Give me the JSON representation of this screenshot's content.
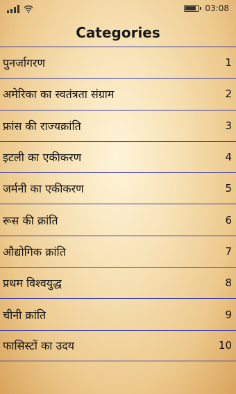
{
  "status": {
    "time": "03:08",
    "battery_level": 0.85,
    "signal_bars": 4
  },
  "header": {
    "title": "Categories"
  },
  "categories": [
    {
      "label": "पुनर्जागरण",
      "number": "1"
    },
    {
      "label": "अमेरिका का स्वतंत्रता संग्राम",
      "number": "2"
    },
    {
      "label": "फ्रांस की राज्यक्रांति",
      "number": "3"
    },
    {
      "label": "इटली का एकीकरण",
      "number": "4"
    },
    {
      "label": "जर्मनी का एकीकरण",
      "number": "5"
    },
    {
      "label": "रूस की क्रांति",
      "number": "6"
    },
    {
      "label": "औद्योगिक क्रांति",
      "number": "7"
    },
    {
      "label": "प्रथम विश्वयुद्ध",
      "number": "8"
    },
    {
      "label": "चीनी क्रांति",
      "number": "9"
    },
    {
      "label": "फासिस्टों का उदय",
      "number": "10"
    }
  ]
}
